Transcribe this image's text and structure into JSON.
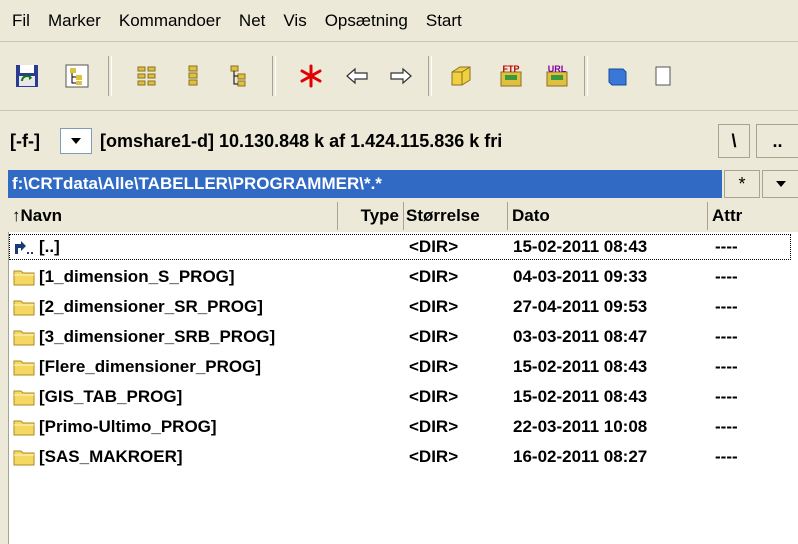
{
  "menu": [
    "Fil",
    "Marker",
    "Kommandoer",
    "Net",
    "Vis",
    "Opsætning",
    "Start"
  ],
  "toolbar": {
    "icons": [
      "refresh-icon",
      "tree-icon",
      "brief-view-icon",
      "full-view-icon",
      "tree-view-icon",
      "filter-icon",
      "back-icon",
      "forward-icon",
      "archive-icon",
      "ftp-icon",
      "url-icon",
      "notes-icon"
    ]
  },
  "drive": {
    "label": "[-f-]",
    "info": "[omshare1-d]  10.130.848 k af 1.424.115.836 k fri",
    "root_label": "\\",
    "up_label": ".."
  },
  "path": {
    "text": "f:\\CRTdata\\Alle\\TABELLER\\PROGRAMMER\\*.*",
    "filter_label": "*"
  },
  "columns": {
    "name": "↑Navn",
    "type": "Type",
    "size": "Størrelse",
    "date": "Dato",
    "attr": "Attr"
  },
  "files": [
    {
      "name": "[..]",
      "size": "<DIR>",
      "date": "15-02-2011 08:43",
      "attr": "----"
    },
    {
      "name": "[1_dimension_S_PROG]",
      "size": "<DIR>",
      "date": "04-03-2011 09:33",
      "attr": "----"
    },
    {
      "name": "[2_dimensioner_SR_PROG]",
      "size": "<DIR>",
      "date": "27-04-2011 09:53",
      "attr": "----"
    },
    {
      "name": "[3_dimensioner_SRB_PROG]",
      "size": "<DIR>",
      "date": "03-03-2011 08:47",
      "attr": "----"
    },
    {
      "name": "[Flere_dimensioner_PROG]",
      "size": "<DIR>",
      "date": "15-02-2011 08:43",
      "attr": "----"
    },
    {
      "name": "[GIS_TAB_PROG]",
      "size": "<DIR>",
      "date": "15-02-2011 08:43",
      "attr": "----"
    },
    {
      "name": "[Primo-Ultimo_PROG]",
      "size": "<DIR>",
      "date": "22-03-2011 10:08",
      "attr": "----"
    },
    {
      "name": "[SAS_MAKROER]",
      "size": "<DIR>",
      "date": "16-02-2011 08:27",
      "attr": "----"
    }
  ]
}
